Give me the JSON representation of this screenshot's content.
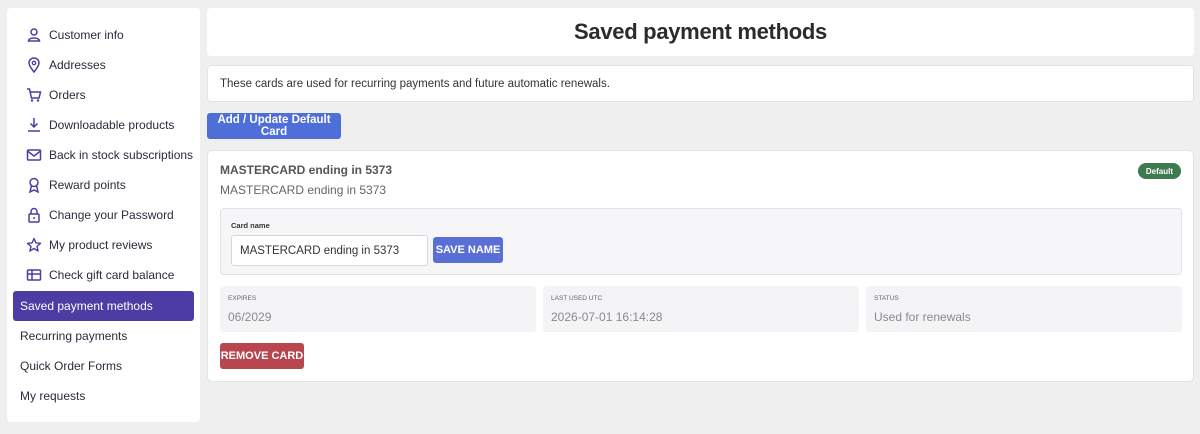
{
  "sidebar": {
    "items": [
      {
        "label": "Customer info",
        "icon": "user-icon"
      },
      {
        "label": "Addresses",
        "icon": "map-pin-icon"
      },
      {
        "label": "Orders",
        "icon": "cart-icon"
      },
      {
        "label": "Downloadable products",
        "icon": "download-icon"
      },
      {
        "label": "Back in stock subscriptions",
        "icon": "mail-icon"
      },
      {
        "label": "Reward points",
        "icon": "award-icon"
      },
      {
        "label": "Change your Password",
        "icon": "lock-icon"
      },
      {
        "label": "My product reviews",
        "icon": "star-icon"
      },
      {
        "label": "Check gift card balance",
        "icon": "gift-card-icon"
      },
      {
        "label": "Saved payment methods"
      },
      {
        "label": "Recurring payments"
      },
      {
        "label": "Quick Order Forms"
      },
      {
        "label": "My requests"
      }
    ],
    "active_index": 9
  },
  "page": {
    "title": "Saved payment methods",
    "info": "These cards are used for recurring payments and future automatic renewals.",
    "add_button": "Add / Update Default Card"
  },
  "card": {
    "title": "MASTERCARD ending in 5373",
    "subtitle": "MASTERCARD ending in 5373",
    "badge": "Default",
    "name_label": "Card name",
    "name_value": "MASTERCARD ending in 5373",
    "save_button": "SAVE NAME",
    "stats": [
      {
        "label": "EXPIRES",
        "value": "06/2029"
      },
      {
        "label": "LAST USED UTC",
        "value": "2026-07-01 16:14:28"
      },
      {
        "label": "STATUS",
        "value": "Used for renewals"
      }
    ],
    "remove_button": "REMOVE CARD"
  },
  "colors": {
    "active_nav": "#4d3ca3",
    "primary_button": "#4f6fd8",
    "danger_button": "#b8464f",
    "badge": "#3d7a4f"
  }
}
